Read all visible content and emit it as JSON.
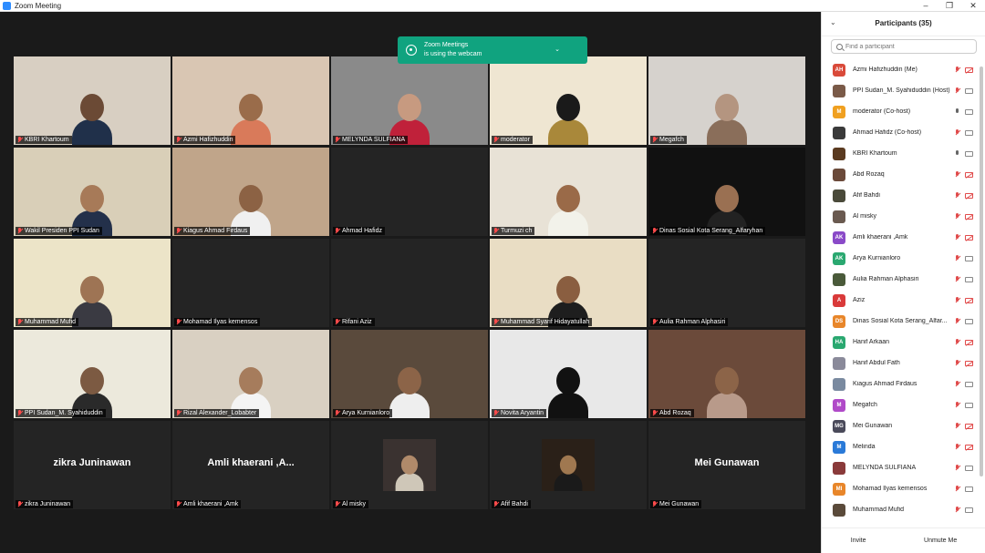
{
  "window": {
    "title": "Zoom Meeting"
  },
  "notification": {
    "line1": "Zoom Meetings",
    "line2": "is using the webcam"
  },
  "gallery": {
    "tiles": [
      {
        "name": "KBRI Khartoum",
        "type": "video",
        "bg": "#d8cfc2",
        "skin": "#6b4a35",
        "shirt": "#20304a"
      },
      {
        "name": "Azmi Hafizhuddin",
        "type": "video",
        "bg": "#d9c6b3",
        "skin": "#9a6c4a",
        "shirt": "#d97a5a"
      },
      {
        "name": "MELYNDA SULFIANA",
        "type": "video",
        "bg": "#8a8a8a",
        "skin": "#c79a80",
        "shirt": "#c0213a"
      },
      {
        "name": "moderator",
        "type": "video",
        "bg": "#efe6d2",
        "skin": "#1a1a1a",
        "shirt": "#a9883a",
        "active": true
      },
      {
        "name": "Megafch",
        "type": "video",
        "bg": "#d6d2cd",
        "skin": "#b49580",
        "shirt": "#8a6e5a"
      },
      {
        "name": "Wakil Presiden PPI Sudan",
        "type": "video",
        "bg": "#d9cfb8",
        "skin": "#a77a58",
        "shirt": "#23304a"
      },
      {
        "name": "Kiagus Ahmad Firdaus",
        "type": "video",
        "bg": "#c0a58a",
        "skin": "#8c6244",
        "shirt": "#f0f0f0"
      },
      {
        "name": "Ahmad Hafidz",
        "type": "off"
      },
      {
        "name": "Turmuzi ch",
        "type": "video",
        "bg": "#e8e2d6",
        "skin": "#9a6a48",
        "shirt": "#f2f2ea"
      },
      {
        "name": "Dinas Sosial Kota Serang_Alfaryhan",
        "type": "video",
        "bg": "#111111",
        "skin": "#9a7052",
        "shirt": "#222222"
      },
      {
        "name": "Muhammad Mufid",
        "type": "video",
        "bg": "#ece4c8",
        "skin": "#9e7454",
        "shirt": "#3a3a42"
      },
      {
        "name": "Mohamad Ilyas kemensos",
        "type": "off"
      },
      {
        "name": "Rifani Aziz",
        "type": "off"
      },
      {
        "name": "Muhammad Syarif Hidayatullah",
        "type": "video",
        "bg": "#e9ddc4",
        "skin": "#8a5e40",
        "shirt": "#1e1e1e"
      },
      {
        "name": "Aulia Rahman Alphasiri",
        "type": "off"
      },
      {
        "name": "PPI Sudan_M. Syahiduddin",
        "type": "video",
        "bg": "#ece9dc",
        "skin": "#7c5a42",
        "shirt": "#2a2a2a"
      },
      {
        "name": "Rizal Alexander_Lobabter",
        "type": "video",
        "bg": "#d9d0c2",
        "skin": "#a67c5c",
        "shirt": "#f4f4f4"
      },
      {
        "name": "Arya Kurnianloro",
        "type": "video",
        "bg": "#5a4a3c",
        "skin": "#8c6448",
        "shirt": "#eeeeee"
      },
      {
        "name": "Novita Aryantin",
        "type": "video",
        "bg": "#e8e8e8",
        "skin": "#111111",
        "shirt": "#111111"
      },
      {
        "name": "Abd Rozaq",
        "type": "video",
        "bg": "#6b4a3a",
        "skin": "#8c6448",
        "shirt": "#b89a8a"
      },
      {
        "name": "zikra Juninawan",
        "type": "name",
        "display": "zikra Juninawan"
      },
      {
        "name": "Amli khaerani ,Amk",
        "type": "name",
        "display": "Amli  khaerani ,A..."
      },
      {
        "name": "Al misky",
        "type": "photo",
        "bg": "#3a3230",
        "skin": "#b08a6a",
        "shirt": "#cfc7b8"
      },
      {
        "name": "Afif Bahdi",
        "type": "photo",
        "bg": "#2a2018",
        "skin": "#a07850",
        "shirt": "#1a1a1a"
      },
      {
        "name": "Mei Gunawan",
        "type": "name",
        "display": "Mei Gunawan"
      }
    ]
  },
  "participants": {
    "title": "Participants (35)",
    "search_placeholder": "Find a participant",
    "items": [
      {
        "name": "Azmi Hafizhuddin (Me)",
        "initials": "AH",
        "color": "#d94a3a",
        "mic": false,
        "cam": false
      },
      {
        "name": "PPI Sudan_M. Syahiduddin (Host)",
        "initials": "",
        "color": "#7a5a48",
        "mic": false,
        "cam": true
      },
      {
        "name": "moderator (Co-host)",
        "initials": "M",
        "color": "#f0a020",
        "mic": true,
        "cam": true
      },
      {
        "name": "Ahmad Hafidz (Co-host)",
        "initials": "",
        "color": "#3a3a3a",
        "mic": false,
        "cam": true
      },
      {
        "name": "KBRI Khartoum",
        "initials": "",
        "color": "#5a3a20",
        "mic": true,
        "cam": true
      },
      {
        "name": "Abd Rozaq",
        "initials": "",
        "color": "#6b4a3a",
        "mic": false,
        "cam": false
      },
      {
        "name": "Afif Bahdi",
        "initials": "",
        "color": "#4a4a3a",
        "mic": false,
        "cam": false
      },
      {
        "name": "Al misky",
        "initials": "",
        "color": "#6a5a50",
        "mic": false,
        "cam": false
      },
      {
        "name": "Amli khaerani ,Amk",
        "initials": "AK",
        "color": "#8a4ac8",
        "mic": false,
        "cam": false
      },
      {
        "name": "Arya Kurnianloro",
        "initials": "AK",
        "color": "#2aa870",
        "mic": false,
        "cam": true
      },
      {
        "name": "Aulia Rahman Alphasiri",
        "initials": "",
        "color": "#4a5a3a",
        "mic": false,
        "cam": true
      },
      {
        "name": "Aziz",
        "initials": "A",
        "color": "#d93a3a",
        "mic": false,
        "cam": false
      },
      {
        "name": "Dinas Sosial Kota Serang_Alfar...",
        "initials": "DS",
        "color": "#e8862a",
        "mic": false,
        "cam": true
      },
      {
        "name": "Hanif Arkaan",
        "initials": "HA",
        "color": "#2aa870",
        "mic": false,
        "cam": false
      },
      {
        "name": "Hanif Abdul Fath",
        "initials": "",
        "color": "#8a8a9a",
        "mic": false,
        "cam": false
      },
      {
        "name": "Kiagus Ahmad Firdaus",
        "initials": "",
        "color": "#7a8aa0",
        "mic": false,
        "cam": true
      },
      {
        "name": "Megafch",
        "initials": "M",
        "color": "#b04ac8",
        "mic": false,
        "cam": true
      },
      {
        "name": "Mei Gunawan",
        "initials": "MG",
        "color": "#4a4a5a",
        "mic": false,
        "cam": false
      },
      {
        "name": "Melinda",
        "initials": "M",
        "color": "#2a7ad8",
        "mic": false,
        "cam": false
      },
      {
        "name": "MELYNDA SULFIANA",
        "initials": "",
        "color": "#8a3a3a",
        "mic": false,
        "cam": true
      },
      {
        "name": "Mohamad Ilyas kemensos",
        "initials": "MI",
        "color": "#e8862a",
        "mic": false,
        "cam": true
      },
      {
        "name": "Muhammad Mufid",
        "initials": "",
        "color": "#5a4a3a",
        "mic": false,
        "cam": true
      }
    ],
    "invite_label": "Invite",
    "unmute_label": "Unmute Me"
  }
}
